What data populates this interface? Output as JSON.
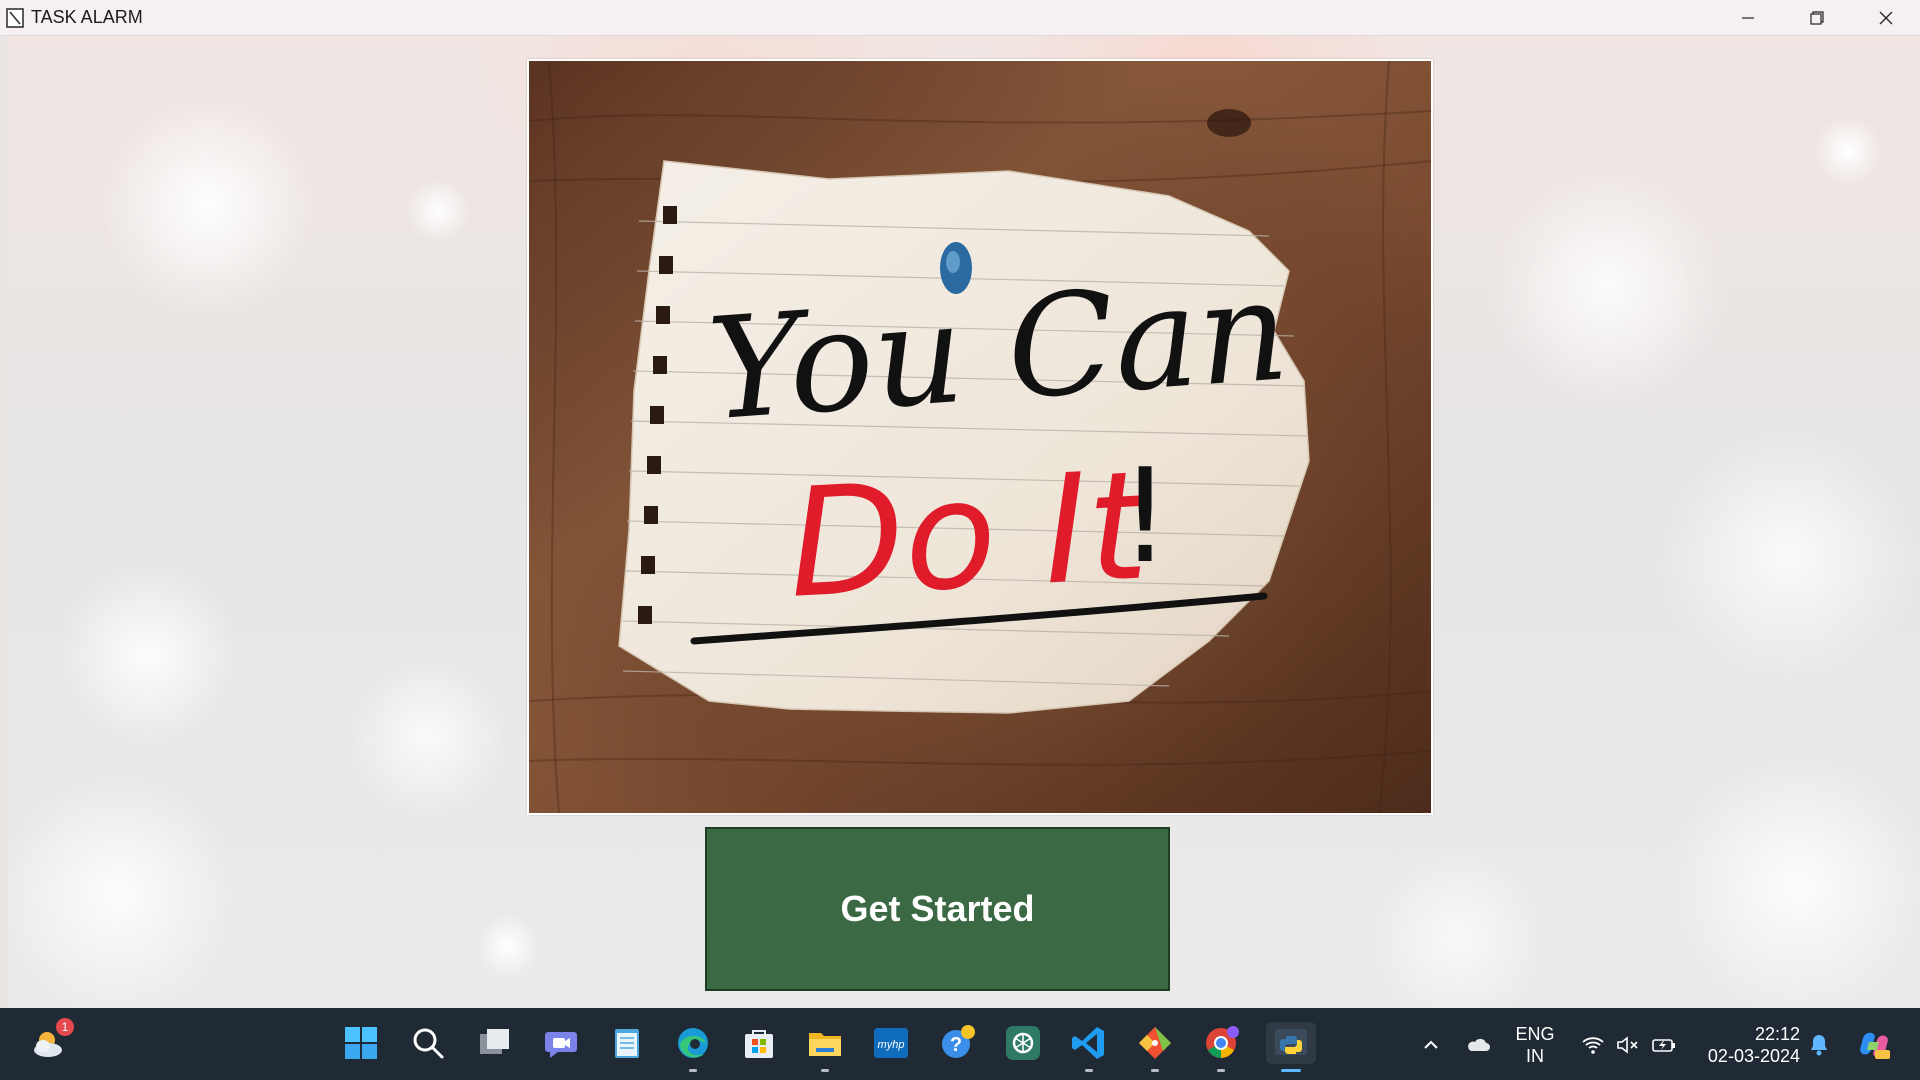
{
  "window": {
    "title": "TASK ALARM"
  },
  "content": {
    "image_text_line1": "You Can",
    "image_text_line2": "Do It",
    "image_text_exclaim": "!",
    "button_label": "Get Started"
  },
  "taskbar": {
    "weather_badge": "1",
    "language_top": "ENG",
    "language_bottom": "IN",
    "time": "22:12",
    "date": "02-03-2024",
    "myhp_label": "myhp",
    "icons": [
      "weather-icon",
      "start-icon",
      "search-icon",
      "task-view-icon",
      "teams-chat-icon",
      "notepad-icon",
      "edge-icon",
      "microsoft-store-icon",
      "file-explorer-icon",
      "myhp-icon",
      "get-help-icon",
      "chatgpt-icon",
      "vscode-icon",
      "git-icon",
      "chrome-icon",
      "python-icon"
    ]
  },
  "colors": {
    "button_bg": "#3a6943",
    "taskbar_bg": "#1f2a35",
    "titlebar_bg": "#f6f0f3"
  }
}
